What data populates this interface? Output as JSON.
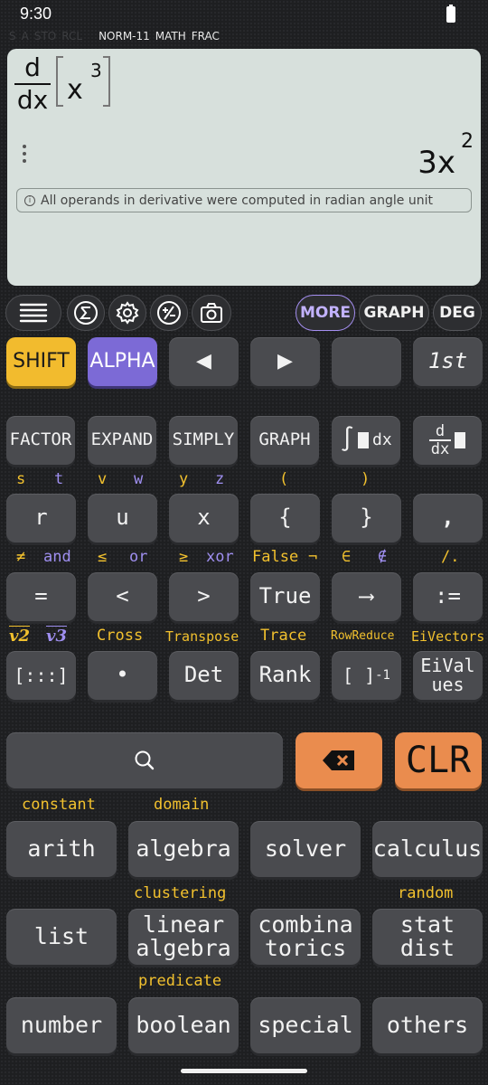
{
  "status": {
    "time": "9:30"
  },
  "indicators": {
    "dim": [
      "S",
      "A",
      "STO",
      "RCL"
    ],
    "active": [
      "NORM-11",
      "MATH",
      "FRAC"
    ]
  },
  "display": {
    "frac_num": "d",
    "frac_den": "dx",
    "expr_base": "x",
    "expr_exp": "3",
    "result_base": "3x",
    "result_exp": "2",
    "note_icon": "i",
    "note": "All operands in derivative were computed in radian angle unit"
  },
  "toolbar": {
    "icons": [
      "menu-icon",
      "sigma-icon",
      "gear-icon",
      "plus-minus-icon",
      "camera-icon"
    ],
    "more": "MORE",
    "graph": "GRAPH",
    "deg": "DEG"
  },
  "row1": {
    "shift": "SHIFT",
    "alpha": "ALPHA",
    "left": "◀",
    "right": "▶",
    "blank": "",
    "first": "1st"
  },
  "row2": {
    "factor": "FACTOR",
    "expand": "EXPAND",
    "simply": "SIMPLY",
    "graph": "GRAPH",
    "integral_sym": "∫",
    "integral_dx": "dx",
    "deriv_num": "d",
    "deriv_den": "dx"
  },
  "row3_labels": [
    "s",
    "t",
    "v",
    "w",
    "y",
    "z",
    "(",
    ")"
  ],
  "row3": [
    "r",
    "u",
    "x",
    "{",
    "}",
    ","
  ],
  "row4_labels": {
    "c1a": "≠",
    "c1b": "and",
    "c2a": "≤",
    "c2b": "or",
    "c3a": "≥",
    "c3b": "xor",
    "c4a": "False",
    "c4b": "¬",
    "c5a": "∈",
    "c5b": "∉",
    "c6a": "/."
  },
  "row4": [
    "=",
    "<",
    ">",
    "True",
    "⟶",
    ":="
  ],
  "row5_labels": {
    "v2": "v2",
    "v3": "v3",
    "cross": "Cross",
    "transpose": "Transpose",
    "trace": "Trace",
    "rowreduce": "RowReduce",
    "eivectors": "EiVectors"
  },
  "row5": {
    "matrix": "[:::]",
    "dot": "•",
    "det": "Det",
    "rank": "Rank",
    "inverse_base": "[ ]",
    "inverse_exp": "-1",
    "eivalues": "EiVal ues"
  },
  "actions": {
    "clr": "CLR"
  },
  "cat_labels": {
    "constant": "constant",
    "domain": "domain",
    "clustering": "clustering",
    "random": "random",
    "predicate": "predicate"
  },
  "categories": {
    "arith": "arith",
    "algebra": "algebra",
    "solver": "solver",
    "calculus": "calculus",
    "list": "list",
    "linear_algebra": "linear algebra",
    "combinatorics": "combina torics",
    "stat_dist": "stat dist",
    "number": "number",
    "boolean": "boolean",
    "special": "special",
    "others": "others"
  },
  "colors": {
    "shift": "#f2bb2e",
    "alpha": "#7c6ad6",
    "clr": "#ea8c4e",
    "display_bg": "#d7e0dc",
    "accent_purple": "#a48ef0"
  }
}
